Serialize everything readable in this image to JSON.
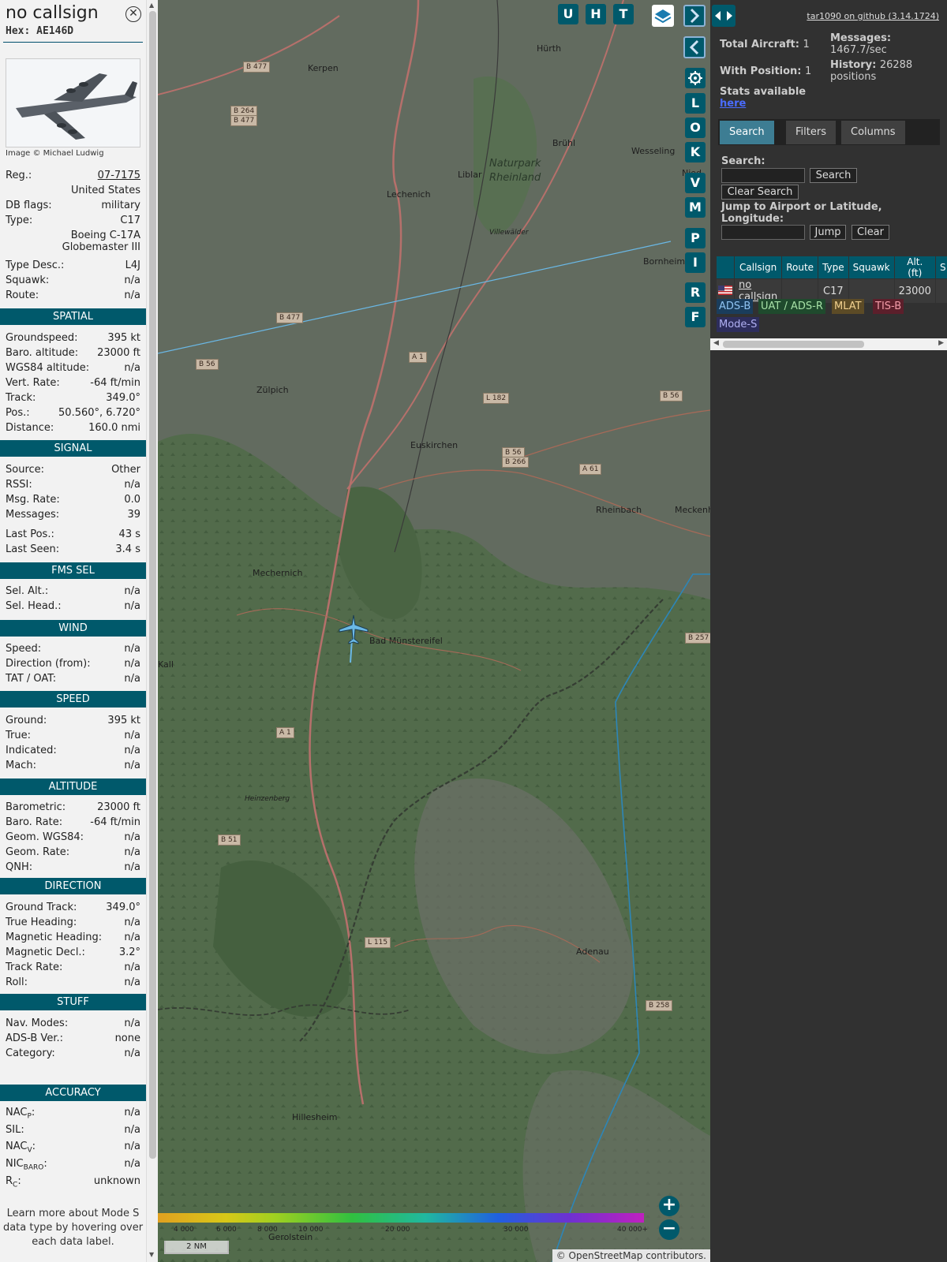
{
  "info": {
    "callsign": "no callsign",
    "hex_label": "Hex:",
    "hex": "AE146D",
    "photo_credit": "Image © Michael Ludwig",
    "rows_top": [
      {
        "k": "Reg.:",
        "v": "07-7175",
        "link": true
      },
      {
        "k": "",
        "v": "United States"
      },
      {
        "k": "DB flags:",
        "v": "military"
      },
      {
        "k": "Type:",
        "v": "C17"
      },
      {
        "k": "",
        "v": "Boeing C-17A"
      },
      {
        "k": "",
        "v": "Globemaster III"
      },
      {
        "k": "Type Desc.:",
        "v": "L4J"
      },
      {
        "k": "Squawk:",
        "v": "n/a"
      },
      {
        "k": "Route:",
        "v": "n/a"
      }
    ],
    "sections": [
      {
        "title": "SPATIAL",
        "rows": [
          {
            "k": "Groundspeed:",
            "v": "395 kt"
          },
          {
            "k": "Baro. altitude:",
            "v": "23000 ft"
          },
          {
            "k": "WGS84 altitude:",
            "v": "n/a"
          },
          {
            "k": "Vert. Rate:",
            "v": "-64 ft/min"
          },
          {
            "k": "Track:",
            "v": "349.0°"
          },
          {
            "k": "Pos.:",
            "v": "50.560°, 6.720°"
          },
          {
            "k": "Distance:",
            "v": "160.0 nmi"
          }
        ]
      },
      {
        "title": "SIGNAL",
        "rows": [
          {
            "k": "Source:",
            "v": "Other"
          },
          {
            "k": "RSSI:",
            "v": "n/a"
          },
          {
            "k": "Msg. Rate:",
            "v": "0.0"
          },
          {
            "k": "Messages:",
            "v": "39"
          },
          {
            "k": "Last Pos.:",
            "v": "43 s"
          },
          {
            "k": "Last Seen:",
            "v": "3.4 s"
          }
        ]
      },
      {
        "title": "FMS SEL",
        "rows": [
          {
            "k": "Sel. Alt.:",
            "v": "n/a"
          },
          {
            "k": "Sel. Head.:",
            "v": "n/a"
          }
        ]
      },
      {
        "title": "WIND",
        "rows": [
          {
            "k": "Speed:",
            "v": "n/a"
          },
          {
            "k": "Direction (from):",
            "v": "n/a"
          },
          {
            "k": "TAT / OAT:",
            "v": "n/a"
          }
        ]
      },
      {
        "title": "SPEED",
        "rows": [
          {
            "k": "Ground:",
            "v": "395 kt"
          },
          {
            "k": "True:",
            "v": "n/a"
          },
          {
            "k": "Indicated:",
            "v": "n/a"
          },
          {
            "k": "Mach:",
            "v": "n/a"
          }
        ]
      },
      {
        "title": "ALTITUDE",
        "rows": [
          {
            "k": "Barometric:",
            "v": "23000 ft"
          },
          {
            "k": "Baro. Rate:",
            "v": "-64 ft/min"
          },
          {
            "k": "Geom. WGS84:",
            "v": "n/a"
          },
          {
            "k": "Geom. Rate:",
            "v": "n/a"
          },
          {
            "k": "QNH:",
            "v": "n/a"
          }
        ]
      },
      {
        "title": "DIRECTION",
        "rows": [
          {
            "k": "Ground Track:",
            "v": "349.0°"
          },
          {
            "k": "True Heading:",
            "v": "n/a"
          },
          {
            "k": "Magnetic Heading:",
            "v": "n/a"
          },
          {
            "k": "Magnetic Decl.:",
            "v": "3.2°"
          },
          {
            "k": "Track Rate:",
            "v": "n/a"
          },
          {
            "k": "Roll:",
            "v": "n/a"
          }
        ]
      },
      {
        "title": "STUFF",
        "rows": [
          {
            "k": "Nav. Modes:",
            "v": "n/a"
          },
          {
            "k": "ADS-B Ver.:",
            "v": "none"
          },
          {
            "k": "Category:",
            "v": "n/a"
          }
        ]
      },
      {
        "title": "ACCURACY",
        "rows": [
          {
            "k": "NAC",
            "sub": "P",
            "v": "n/a"
          },
          {
            "k": "SIL:",
            "v": "n/a"
          },
          {
            "k": "NAC",
            "sub": "V",
            "v": "n/a"
          },
          {
            "k": "NIC",
            "sub": "BARO",
            "v": "n/a"
          },
          {
            "k": "R",
            "sub": "C",
            "v": "unknown"
          }
        ]
      }
    ],
    "note": "Learn more about Mode S data type by hovering over each data label."
  },
  "map": {
    "buttons_top": [
      "U",
      "H",
      "T"
    ],
    "buttons_side": [
      "L",
      "O",
      "K",
      "V",
      "M",
      "P",
      "I",
      "R",
      "F"
    ],
    "places": [
      {
        "t": "Kerpen"
      },
      {
        "t": "Hürth"
      },
      {
        "t": "Brühl"
      },
      {
        "t": "Wesseling"
      },
      {
        "t": "Lechenich"
      },
      {
        "t": "Liblar"
      },
      {
        "t": "Naturpark"
      },
      {
        "t": "Rheinland"
      },
      {
        "t": "Villewälder"
      },
      {
        "t": "Bornheim"
      },
      {
        "t": "Zülpich"
      },
      {
        "t": "Euskirchen"
      },
      {
        "t": "Rheinbach"
      },
      {
        "t": "Meckenh"
      },
      {
        "t": "Mechernich"
      },
      {
        "t": "Bad Münstereifel"
      },
      {
        "t": "Kall"
      },
      {
        "t": "Heinzenberg"
      },
      {
        "t": "Adenau"
      },
      {
        "t": "Hillesheim"
      },
      {
        "t": "Gerolstein"
      },
      {
        "t": "Nied"
      }
    ],
    "roads": [
      {
        "t": "B 477"
      },
      {
        "t": "B 264"
      },
      {
        "t": "B 477"
      },
      {
        "t": "B 477"
      },
      {
        "t": "B 56"
      },
      {
        "t": "A 1"
      },
      {
        "t": "L 182"
      },
      {
        "t": "B 56"
      },
      {
        "t": "B 56"
      },
      {
        "t": "B 266"
      },
      {
        "t": "A 61"
      },
      {
        "t": "B 257"
      },
      {
        "t": "A 1"
      },
      {
        "t": "B 51"
      },
      {
        "t": "L 115"
      },
      {
        "t": "B 258"
      }
    ],
    "alt_scale": [
      "4 000",
      "6 000",
      "8 000",
      "10 000",
      "20 000",
      "30 000",
      "40 000+"
    ],
    "scale_label": "2 NM",
    "attribution": "© OpenStreetMap contributors."
  },
  "side": {
    "github_link": "tar1090 on github (3.14.1724)",
    "total_aircraft_label": "Total Aircraft:",
    "total_aircraft": "1",
    "with_position_label": "With Position:",
    "with_position": "1",
    "messages_label": "Messages:",
    "messages_rate": "1467.7/sec",
    "history_label": "History:",
    "history_value": "26288",
    "history_unit": "positions",
    "stats_text": "Stats available",
    "stats_link": "here",
    "tabs": [
      "Search",
      "Filters",
      "Columns"
    ],
    "search_label": "Search:",
    "search_button": "Search",
    "clear_search_button": "Clear Search",
    "jump_label": "Jump to Airport or Latitude, Longitude:",
    "jump_button": "Jump",
    "clear_button": "Clear",
    "table_headers": [
      "Callsign",
      "Route",
      "Type",
      "Squawk",
      "Alt. (ft)",
      "S"
    ],
    "table_rows": [
      {
        "callsign": "no callsign",
        "route": "",
        "type": "C17",
        "squawk": "",
        "alt": "23000"
      }
    ],
    "badges": [
      {
        "t": "ADS-B",
        "bg": "#1a3d5c",
        "fg": "#8fc3f2"
      },
      {
        "t": "UAT / ADS-R",
        "bg": "#1f4a2d",
        "fg": "#a6e0a6"
      },
      {
        "t": "MLAT",
        "bg": "#5c4b26",
        "fg": "#f2d18f"
      },
      {
        "t": "TIS-B",
        "bg": "#5c1f2b",
        "fg": "#f29ba8"
      },
      {
        "t": "Mode-S",
        "bg": "#2d2d5c",
        "fg": "#b0b0f2"
      }
    ],
    "colors": {
      "accent": "#00596b",
      "tab_active": "#3d7d93",
      "background": "#313131"
    }
  }
}
